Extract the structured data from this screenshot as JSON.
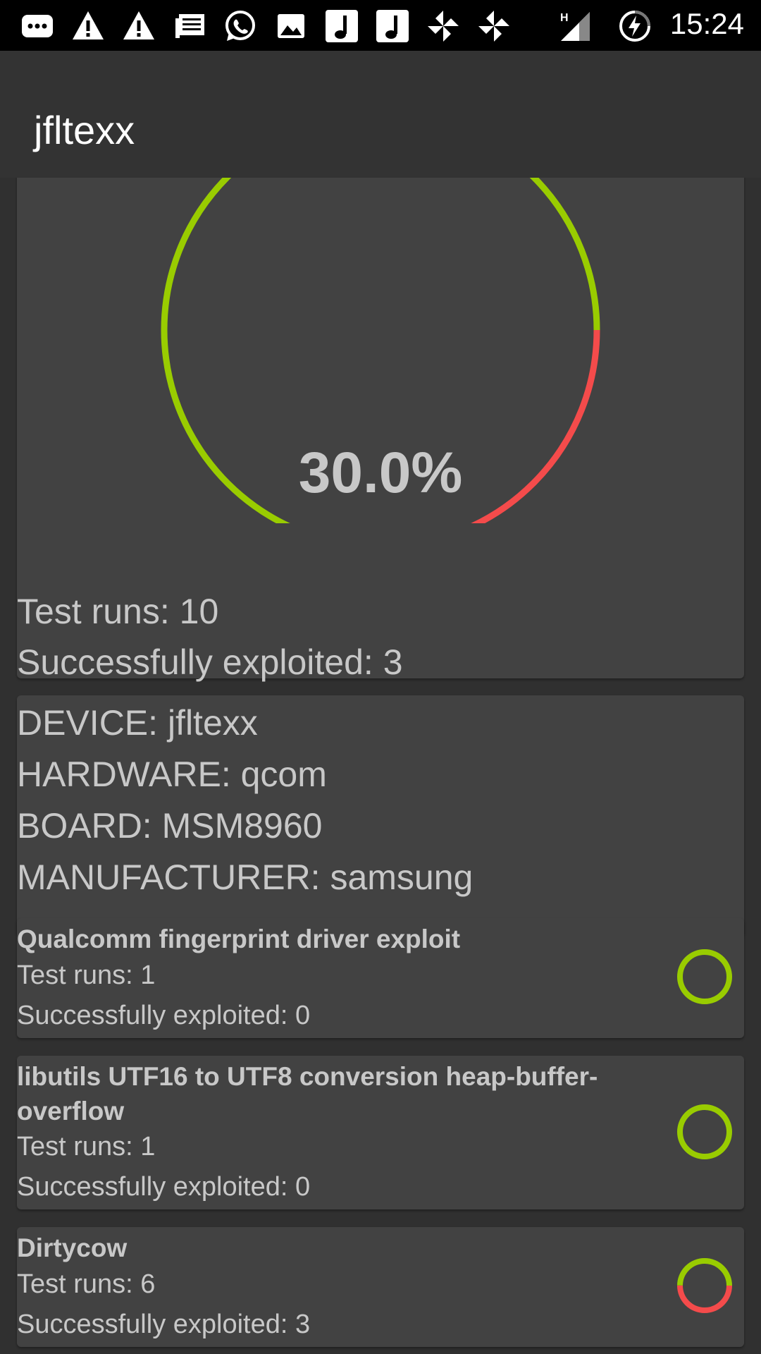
{
  "status_bar": {
    "time": "15:24",
    "icons": [
      "message-icon",
      "warning-icon",
      "warning-icon",
      "news-icon",
      "whatsapp-icon",
      "image-icon",
      "music-icon",
      "music-icon",
      "pinwheel-icon",
      "pinwheel-icon",
      "signal-h-icon",
      "battery-charging-icon"
    ]
  },
  "app_bar": {
    "title": "jfltexx"
  },
  "summary": {
    "percent_text": "30.0%",
    "success_fraction": 0.3,
    "test_runs": "Test runs: 10",
    "exploited": "Successfully exploited: 3"
  },
  "device": {
    "device": "DEVICE: jfltexx",
    "hardware": "HARDWARE: qcom",
    "board": "BOARD: MSM8960",
    "manufacturer": "MANUFACTURER: samsung"
  },
  "exploits": [
    {
      "name": "Qualcomm fingerprint driver exploit",
      "test_runs": "Test runs: 1",
      "exploited": "Successfully exploited: 0",
      "success_fraction": 0
    },
    {
      "name": "libutils UTF16 to UTF8 conversion heap-buffer-overflow",
      "test_runs": "Test runs: 1",
      "exploited": "Successfully exploited: 0",
      "success_fraction": 0
    },
    {
      "name": "Dirtycow",
      "test_runs": "Test runs: 6",
      "exploited": "Successfully exploited: 3",
      "success_fraction": 0.5
    }
  ],
  "colors": {
    "safe": "#99cc00",
    "exploited": "#f44b4b"
  }
}
